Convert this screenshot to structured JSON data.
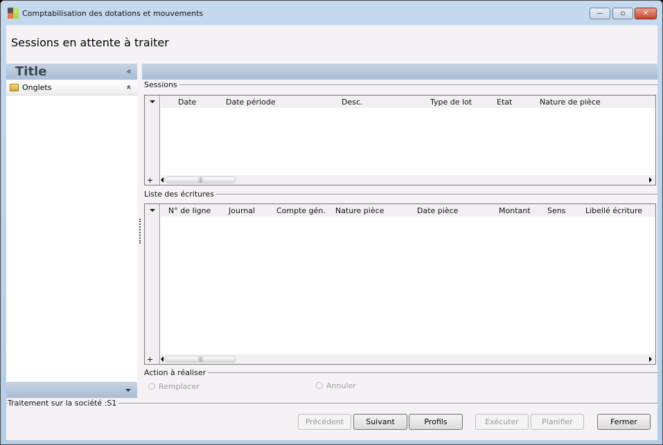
{
  "window": {
    "title": "Comptabilisation des dotations et mouvements",
    "minimize": "—",
    "maximize": "▫",
    "close": "✕"
  },
  "page_title": "Sessions en attente à traiter",
  "left_panel": {
    "title": "Title",
    "collapse_icon": "«",
    "item": "Onglets",
    "item_icon": "»"
  },
  "sessions": {
    "label": "Sessions",
    "columns": [
      "Date",
      "Date période",
      "Desc.",
      "Type de lot",
      "Etat",
      "Nature de pièce"
    ]
  },
  "ecritures": {
    "label": "Liste des écritures",
    "columns": [
      "N° de ligne",
      "Journal",
      "Compte gén.",
      "Nature pièce",
      "Date pièce",
      "Montant",
      "Sens",
      "Libellé écriture"
    ]
  },
  "action": {
    "label": "Action à réaliser",
    "options": [
      "Remplacer",
      "Annuler"
    ]
  },
  "footer": {
    "label": "Traitement sur la société :S1"
  },
  "buttons": {
    "prev": "Précédent",
    "next": "Suivant",
    "profiles": "Profils",
    "execute": "Exécuter",
    "schedule": "Planifier",
    "close": "Fermer"
  }
}
